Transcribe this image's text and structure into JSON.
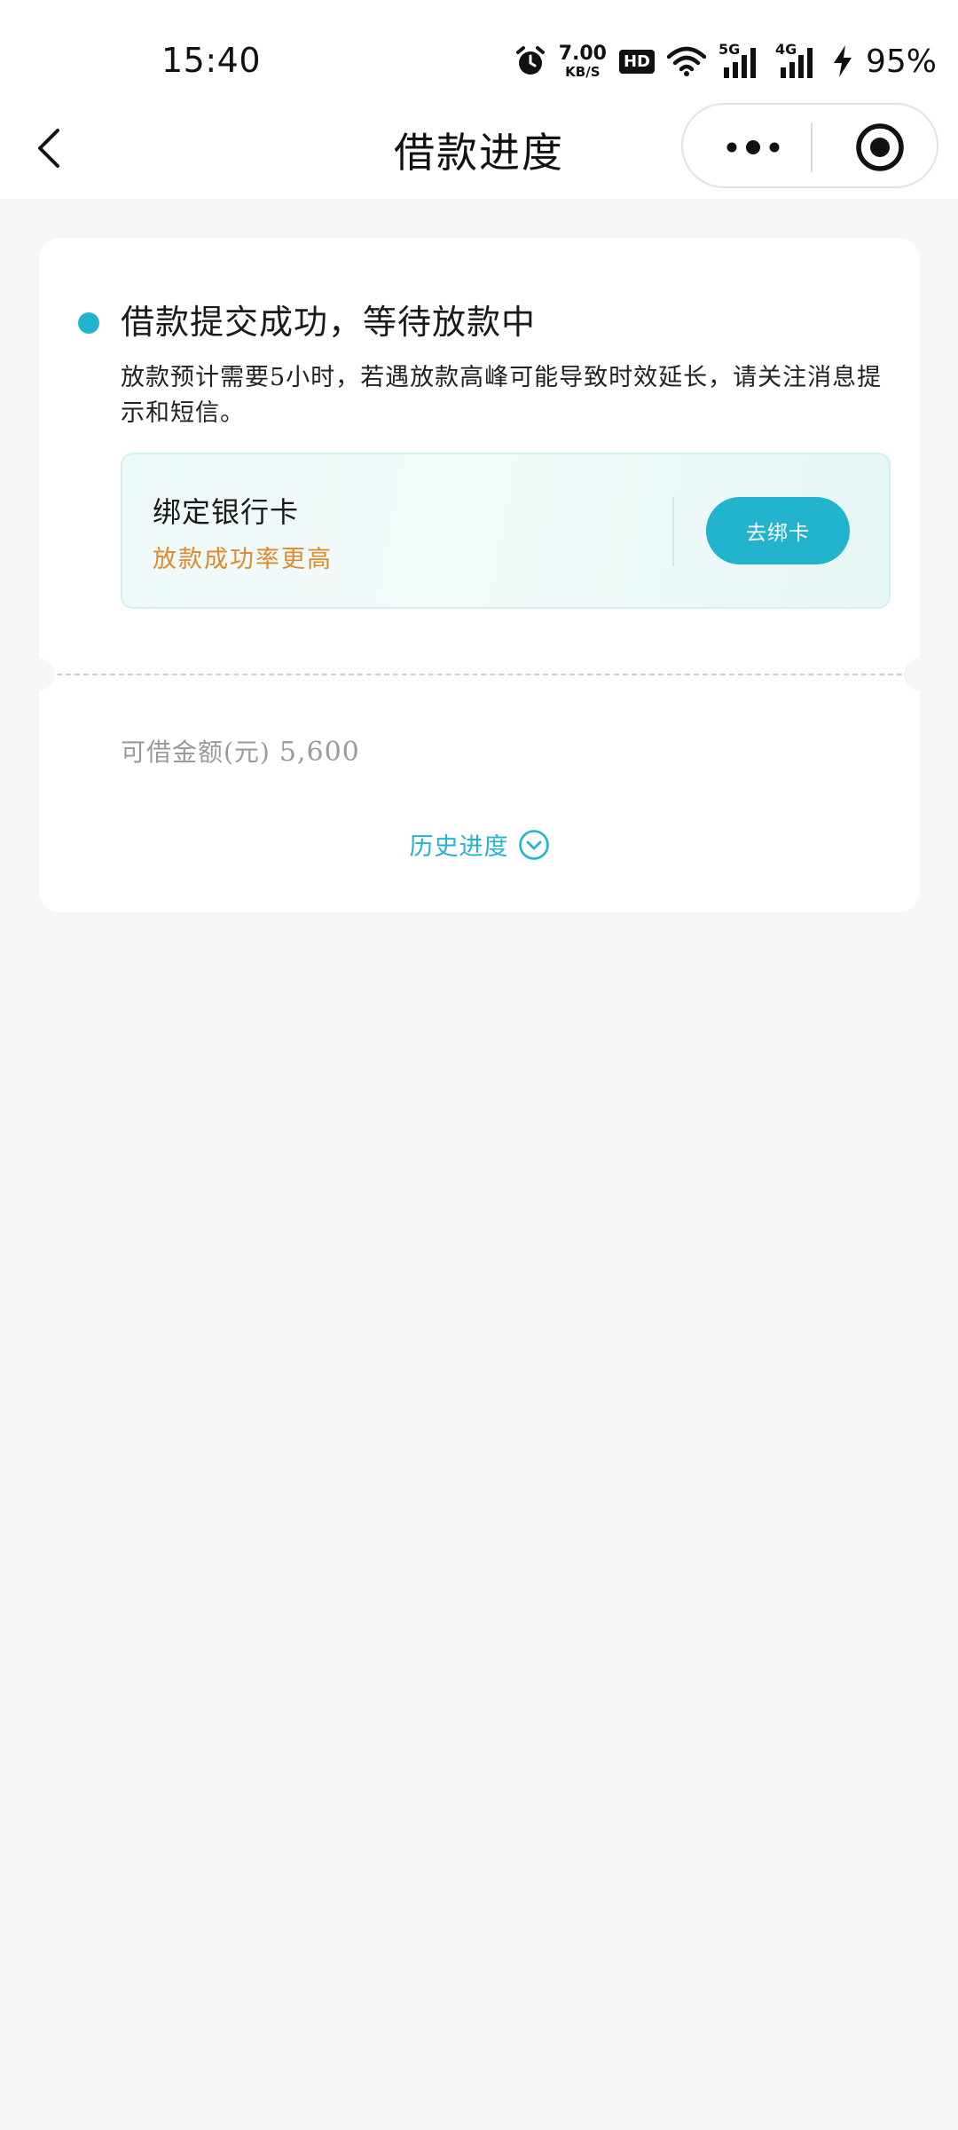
{
  "status_bar": {
    "time": "15:40",
    "net_speed_value": "7.00",
    "net_speed_unit": "KB/S",
    "hd_label": "HD",
    "signal_1_label": "5G",
    "signal_2_label": "4G",
    "battery": "95%"
  },
  "navbar": {
    "title": "借款进度"
  },
  "card": {
    "status_title": "借款提交成功，等待放款中",
    "description": "放款预计需要5小时，若遇放款高峰可能导致时效延长，请关注消息提示和短信。",
    "bind": {
      "title": "绑定银行卡",
      "subtitle": "放款成功率更高",
      "button_label": "去绑卡"
    },
    "amount_label": "可借金额(元)",
    "amount_value": "5,600",
    "history_label": "历史进度"
  },
  "colors": {
    "accent": "#22b3cd",
    "warning_text": "#e08a2a",
    "background": "#f6f6f6"
  }
}
